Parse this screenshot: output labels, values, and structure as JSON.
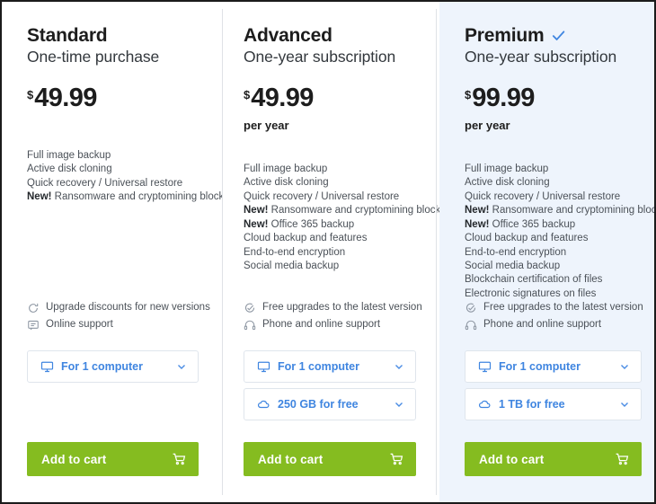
{
  "plans": [
    {
      "id": "standard",
      "name": "Standard",
      "subtitle": "One-time purchase",
      "recommended": false,
      "currency": "$",
      "price": "49.99",
      "period": "",
      "features": [
        {
          "badge": "",
          "text": "Full image backup"
        },
        {
          "badge": "",
          "text": "Active disk cloning"
        },
        {
          "badge": "",
          "text": "Quick recovery / Universal restore"
        },
        {
          "badge": "New!",
          "text": "Ransomware and cryptomining blocker"
        }
      ],
      "support": [
        {
          "icon": "refresh-icon",
          "text": "Upgrade discounts for new versions"
        },
        {
          "icon": "chat-bubble-icon",
          "text": "Online support"
        }
      ],
      "selectors": [
        {
          "icon": "desktop-icon",
          "label": "For 1 computer"
        }
      ],
      "cart_label": "Add to cart",
      "cart_icon": "shopping-cart-icon"
    },
    {
      "id": "advanced",
      "name": "Advanced",
      "subtitle": "One-year subscription",
      "recommended": false,
      "currency": "$",
      "price": "49.99",
      "period": "per year",
      "features": [
        {
          "badge": "",
          "text": "Full image backup"
        },
        {
          "badge": "",
          "text": "Active disk cloning"
        },
        {
          "badge": "",
          "text": "Quick recovery / Universal restore"
        },
        {
          "badge": "New!",
          "text": "Ransomware and cryptomining blocker"
        },
        {
          "badge": "New!",
          "text": "Office 365 backup"
        },
        {
          "badge": "",
          "text": "Cloud backup and features"
        },
        {
          "badge": "",
          "text": "End-to-end encryption"
        },
        {
          "badge": "",
          "text": "Social media backup"
        }
      ],
      "support": [
        {
          "icon": "check-refresh-icon",
          "text": "Free upgrades to the latest version"
        },
        {
          "icon": "headset-icon",
          "text": "Phone and online support"
        }
      ],
      "selectors": [
        {
          "icon": "desktop-icon",
          "label": "For 1 computer"
        },
        {
          "icon": "cloud-icon",
          "label": "250 GB for free"
        }
      ],
      "cart_label": "Add to cart",
      "cart_icon": "shopping-cart-icon"
    },
    {
      "id": "premium",
      "name": "Premium",
      "subtitle": "One-year subscription",
      "recommended": true,
      "recommended_icon": "check-icon",
      "currency": "$",
      "price": "99.99",
      "period": "per year",
      "features": [
        {
          "badge": "",
          "text": "Full image backup"
        },
        {
          "badge": "",
          "text": "Active disk cloning"
        },
        {
          "badge": "",
          "text": "Quick recovery / Universal restore"
        },
        {
          "badge": "New!",
          "text": "Ransomware and cryptomining blocker"
        },
        {
          "badge": "New!",
          "text": "Office 365 backup"
        },
        {
          "badge": "",
          "text": "Cloud backup and features"
        },
        {
          "badge": "",
          "text": "End-to-end encryption"
        },
        {
          "badge": "",
          "text": "Social media backup"
        },
        {
          "badge": "",
          "text": "Blockchain certification of files"
        },
        {
          "badge": "",
          "text": "Electronic signatures on files"
        }
      ],
      "support": [
        {
          "icon": "check-refresh-icon",
          "text": "Free upgrades to the latest version"
        },
        {
          "icon": "headset-icon",
          "text": "Phone and online support"
        }
      ],
      "selectors": [
        {
          "icon": "desktop-icon",
          "label": "For 1 computer"
        },
        {
          "icon": "cloud-icon",
          "label": "1 TB for free"
        }
      ],
      "cart_label": "Add to cart",
      "cart_icon": "shopping-cart-icon"
    }
  ],
  "colors": {
    "accent_blue": "#3f85e0",
    "cart_green": "#85bc20",
    "premium_background": "#eef4fc",
    "divider": "#dfe2e6",
    "feature_text": "#4b5158",
    "heading_text": "#1d1d1d"
  }
}
